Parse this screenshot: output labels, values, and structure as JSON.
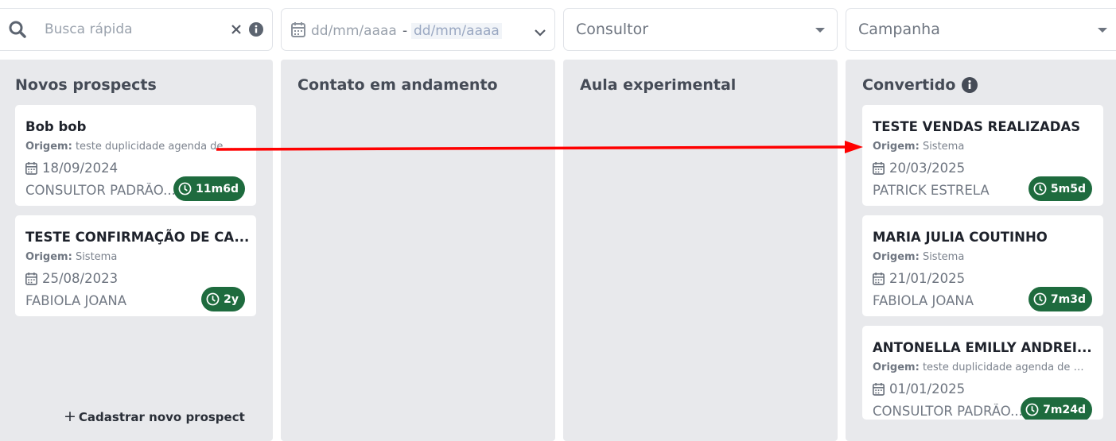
{
  "filters": {
    "search": {
      "placeholder": "Busca rápida"
    },
    "date_range": {
      "start_placeholder": "dd/mm/aaaa",
      "separator": "-",
      "end_placeholder": "dd/mm/aaaa"
    },
    "consultant": {
      "label": "Consultor"
    },
    "campaign": {
      "label": "Campanha"
    }
  },
  "columns": [
    {
      "title": "Novos prospects",
      "cards": [
        {
          "name": "Bob bob",
          "origin_label": "Origem:",
          "origin": "teste duplicidade agenda de cr...",
          "date": "18/09/2024",
          "consultant": "CONSULTOR PADRÃO...",
          "age": "11m6d"
        },
        {
          "name": "TESTE CONFIRMAÇÃO DE CA...",
          "origin_label": "Origem:",
          "origin": "Sistema",
          "date": "25/08/2023",
          "consultant": "FABIOLA JOANA",
          "age": "2y"
        }
      ],
      "add_button": "Cadastrar novo prospect"
    },
    {
      "title": "Contato em andamento",
      "cards": []
    },
    {
      "title": "Aula experimental",
      "cards": []
    },
    {
      "title": "Convertido",
      "cards": [
        {
          "name": "TESTE VENDAS REALIZADAS",
          "origin_label": "Origem:",
          "origin": "Sistema",
          "date": "20/03/2025",
          "consultant": "PATRICK ESTRELA",
          "age": "5m5d"
        },
        {
          "name": "MARIA JULIA COUTINHO",
          "origin_label": "Origem:",
          "origin": "Sistema",
          "date": "21/01/2025",
          "consultant": "FABIOLA JOANA",
          "age": "7m3d"
        },
        {
          "name": "ANTONELLA EMILLY ANDREI...",
          "origin_label": "Origem:",
          "origin": "teste duplicidade agenda de cr...",
          "date": "01/01/2025",
          "consultant": "CONSULTOR PADRÃO...",
          "age": "7m24d"
        }
      ]
    }
  ],
  "colors": {
    "badge": "#1e6b3e",
    "column_bg": "#e8e9ec",
    "annotation_arrow": "#ff0000"
  },
  "icons": {
    "search": "search-icon",
    "clear": "close-icon",
    "info": "info-icon",
    "calendar": "calendar-icon",
    "clock": "clock-icon",
    "chevron": "chevron-down-icon",
    "plus": "plus-icon"
  }
}
